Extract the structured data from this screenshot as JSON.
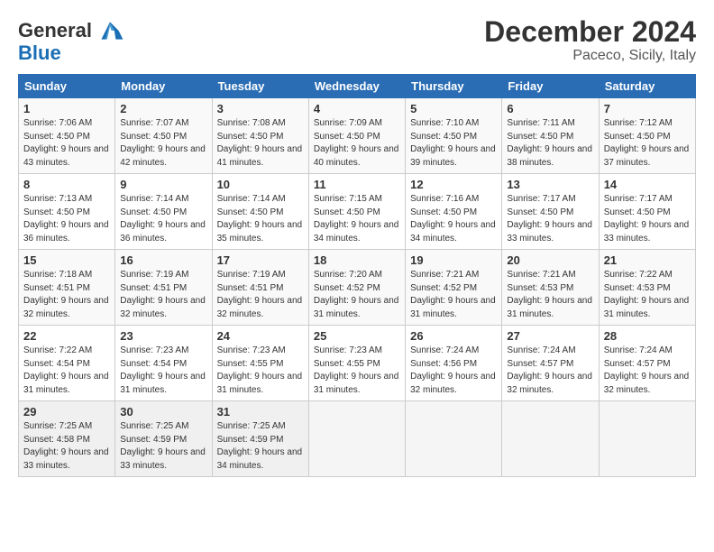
{
  "logo": {
    "line1": "General",
    "line2": "Blue"
  },
  "title": "December 2024",
  "subtitle": "Paceco, Sicily, Italy",
  "days_of_week": [
    "Sunday",
    "Monday",
    "Tuesday",
    "Wednesday",
    "Thursday",
    "Friday",
    "Saturday"
  ],
  "weeks": [
    [
      {
        "day": 1,
        "sunrise": "7:06 AM",
        "sunset": "4:50 PM",
        "daylight": "9 hours and 43 minutes."
      },
      {
        "day": 2,
        "sunrise": "7:07 AM",
        "sunset": "4:50 PM",
        "daylight": "9 hours and 42 minutes."
      },
      {
        "day": 3,
        "sunrise": "7:08 AM",
        "sunset": "4:50 PM",
        "daylight": "9 hours and 41 minutes."
      },
      {
        "day": 4,
        "sunrise": "7:09 AM",
        "sunset": "4:50 PM",
        "daylight": "9 hours and 40 minutes."
      },
      {
        "day": 5,
        "sunrise": "7:10 AM",
        "sunset": "4:50 PM",
        "daylight": "9 hours and 39 minutes."
      },
      {
        "day": 6,
        "sunrise": "7:11 AM",
        "sunset": "4:50 PM",
        "daylight": "9 hours and 38 minutes."
      },
      {
        "day": 7,
        "sunrise": "7:12 AM",
        "sunset": "4:50 PM",
        "daylight": "9 hours and 37 minutes."
      }
    ],
    [
      {
        "day": 8,
        "sunrise": "7:13 AM",
        "sunset": "4:50 PM",
        "daylight": "9 hours and 36 minutes."
      },
      {
        "day": 9,
        "sunrise": "7:14 AM",
        "sunset": "4:50 PM",
        "daylight": "9 hours and 36 minutes."
      },
      {
        "day": 10,
        "sunrise": "7:14 AM",
        "sunset": "4:50 PM",
        "daylight": "9 hours and 35 minutes."
      },
      {
        "day": 11,
        "sunrise": "7:15 AM",
        "sunset": "4:50 PM",
        "daylight": "9 hours and 34 minutes."
      },
      {
        "day": 12,
        "sunrise": "7:16 AM",
        "sunset": "4:50 PM",
        "daylight": "9 hours and 34 minutes."
      },
      {
        "day": 13,
        "sunrise": "7:17 AM",
        "sunset": "4:50 PM",
        "daylight": "9 hours and 33 minutes."
      },
      {
        "day": 14,
        "sunrise": "7:17 AM",
        "sunset": "4:50 PM",
        "daylight": "9 hours and 33 minutes."
      }
    ],
    [
      {
        "day": 15,
        "sunrise": "7:18 AM",
        "sunset": "4:51 PM",
        "daylight": "9 hours and 32 minutes."
      },
      {
        "day": 16,
        "sunrise": "7:19 AM",
        "sunset": "4:51 PM",
        "daylight": "9 hours and 32 minutes."
      },
      {
        "day": 17,
        "sunrise": "7:19 AM",
        "sunset": "4:51 PM",
        "daylight": "9 hours and 32 minutes."
      },
      {
        "day": 18,
        "sunrise": "7:20 AM",
        "sunset": "4:52 PM",
        "daylight": "9 hours and 31 minutes."
      },
      {
        "day": 19,
        "sunrise": "7:21 AM",
        "sunset": "4:52 PM",
        "daylight": "9 hours and 31 minutes."
      },
      {
        "day": 20,
        "sunrise": "7:21 AM",
        "sunset": "4:53 PM",
        "daylight": "9 hours and 31 minutes."
      },
      {
        "day": 21,
        "sunrise": "7:22 AM",
        "sunset": "4:53 PM",
        "daylight": "9 hours and 31 minutes."
      }
    ],
    [
      {
        "day": 22,
        "sunrise": "7:22 AM",
        "sunset": "4:54 PM",
        "daylight": "9 hours and 31 minutes."
      },
      {
        "day": 23,
        "sunrise": "7:23 AM",
        "sunset": "4:54 PM",
        "daylight": "9 hours and 31 minutes."
      },
      {
        "day": 24,
        "sunrise": "7:23 AM",
        "sunset": "4:55 PM",
        "daylight": "9 hours and 31 minutes."
      },
      {
        "day": 25,
        "sunrise": "7:23 AM",
        "sunset": "4:55 PM",
        "daylight": "9 hours and 31 minutes."
      },
      {
        "day": 26,
        "sunrise": "7:24 AM",
        "sunset": "4:56 PM",
        "daylight": "9 hours and 32 minutes."
      },
      {
        "day": 27,
        "sunrise": "7:24 AM",
        "sunset": "4:57 PM",
        "daylight": "9 hours and 32 minutes."
      },
      {
        "day": 28,
        "sunrise": "7:24 AM",
        "sunset": "4:57 PM",
        "daylight": "9 hours and 32 minutes."
      }
    ],
    [
      {
        "day": 29,
        "sunrise": "7:25 AM",
        "sunset": "4:58 PM",
        "daylight": "9 hours and 33 minutes."
      },
      {
        "day": 30,
        "sunrise": "7:25 AM",
        "sunset": "4:59 PM",
        "daylight": "9 hours and 33 minutes."
      },
      {
        "day": 31,
        "sunrise": "7:25 AM",
        "sunset": "4:59 PM",
        "daylight": "9 hours and 34 minutes."
      },
      null,
      null,
      null,
      null
    ]
  ]
}
